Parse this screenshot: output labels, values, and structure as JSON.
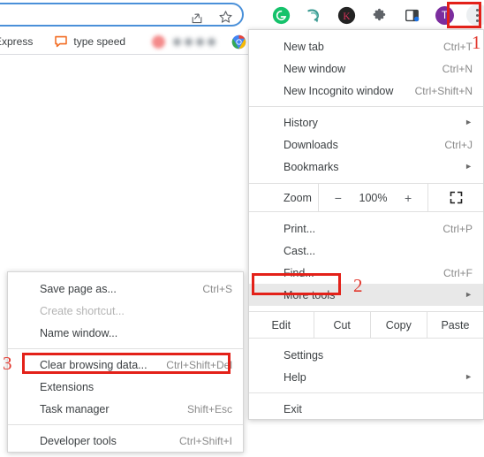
{
  "browser": {
    "omnibox": {
      "share_icon": "share-icon",
      "star_icon": "star-bookmark-icon"
    },
    "extensions": [
      {
        "name": "grammarly-extension-icon",
        "letter": "G",
        "color": "#15c26b"
      },
      {
        "name": "save-to-extension-icon",
        "letter": "",
        "color": "#3a9a92"
      },
      {
        "name": "kaspersky-extension-icon",
        "letter": "K",
        "color": "#2b2b2b"
      },
      {
        "name": "extensions-puzzle-icon",
        "letter": "",
        "color": "#5f6368"
      },
      {
        "name": "side-panel-icon",
        "letter": "",
        "color": "#3c4043"
      }
    ],
    "profile": {
      "name": "profile-avatar",
      "initial": "T",
      "color": "#7b2d9e"
    },
    "menu_button": {
      "name": "chrome-menu-button",
      "icon": "three-dot-kebab-icon"
    }
  },
  "bookmarks_bar": {
    "items": [
      {
        "label": "Express",
        "icon": "none"
      },
      {
        "label": "type speed",
        "icon": "chat-bubble-icon"
      },
      {
        "label": "",
        "icon": "blurred-bookmark"
      },
      {
        "label": "",
        "icon": "chrome-logo-icon"
      }
    ]
  },
  "main_menu": {
    "groups": [
      {
        "items": [
          {
            "label": "New tab",
            "shortcut": "Ctrl+T",
            "arrow": false,
            "highlight": false,
            "disabled": false
          },
          {
            "label": "New window",
            "shortcut": "Ctrl+N",
            "arrow": false,
            "highlight": false,
            "disabled": false
          },
          {
            "label": "New Incognito window",
            "shortcut": "Ctrl+Shift+N",
            "arrow": false,
            "highlight": false,
            "disabled": false
          }
        ]
      },
      {
        "items": [
          {
            "label": "History",
            "shortcut": "",
            "arrow": true,
            "highlight": false,
            "disabled": false
          },
          {
            "label": "Downloads",
            "shortcut": "Ctrl+J",
            "arrow": false,
            "highlight": false,
            "disabled": false
          },
          {
            "label": "Bookmarks",
            "shortcut": "",
            "arrow": true,
            "highlight": false,
            "disabled": false
          }
        ]
      }
    ],
    "zoom_row": {
      "label": "Zoom",
      "minus": "−",
      "value": "100%",
      "plus": "+",
      "fullscreen_icon": "fullscreen-expand-icon"
    },
    "group3": {
      "items": [
        {
          "label": "Print...",
          "shortcut": "Ctrl+P",
          "arrow": false,
          "highlight": false,
          "disabled": false
        },
        {
          "label": "Cast...",
          "shortcut": "",
          "arrow": false,
          "highlight": false,
          "disabled": false
        },
        {
          "label": "Find...",
          "shortcut": "Ctrl+F",
          "arrow": false,
          "highlight": false,
          "disabled": false
        },
        {
          "label": "More tools",
          "shortcut": "",
          "arrow": true,
          "highlight": true,
          "disabled": false
        }
      ]
    },
    "edit_row": {
      "label": "Edit",
      "cut": "Cut",
      "copy": "Copy",
      "paste": "Paste"
    },
    "group4": {
      "items": [
        {
          "label": "Settings",
          "shortcut": "",
          "arrow": false,
          "highlight": false,
          "disabled": false
        },
        {
          "label": "Help",
          "shortcut": "",
          "arrow": true,
          "highlight": false,
          "disabled": false
        }
      ]
    },
    "group5": {
      "items": [
        {
          "label": "Exit",
          "shortcut": "",
          "arrow": false,
          "highlight": false,
          "disabled": false
        }
      ]
    }
  },
  "submenu": {
    "title": "More tools",
    "groups": [
      {
        "items": [
          {
            "label": "Save page as...",
            "shortcut": "Ctrl+S",
            "highlight": false,
            "disabled": false
          },
          {
            "label": "Create shortcut...",
            "shortcut": "",
            "highlight": false,
            "disabled": true
          },
          {
            "label": "Name window...",
            "shortcut": "",
            "highlight": false,
            "disabled": false
          }
        ]
      },
      {
        "items": [
          {
            "label": "Clear browsing data...",
            "shortcut": "Ctrl+Shift+Del",
            "highlight": true,
            "disabled": false
          },
          {
            "label": "Extensions",
            "shortcut": "",
            "highlight": false,
            "disabled": false
          },
          {
            "label": "Task manager",
            "shortcut": "Shift+Esc",
            "highlight": false,
            "disabled": false
          }
        ]
      },
      {
        "items": [
          {
            "label": "Developer tools",
            "shortcut": "Ctrl+Shift+I",
            "highlight": false,
            "disabled": false
          }
        ]
      }
    ]
  },
  "annotations": {
    "color": "#e32119",
    "steps": [
      {
        "number": "1",
        "target": "chrome-menu-button"
      },
      {
        "number": "2",
        "target": "more-tools-item"
      },
      {
        "number": "3",
        "target": "clear-browsing-data-item"
      }
    ]
  }
}
